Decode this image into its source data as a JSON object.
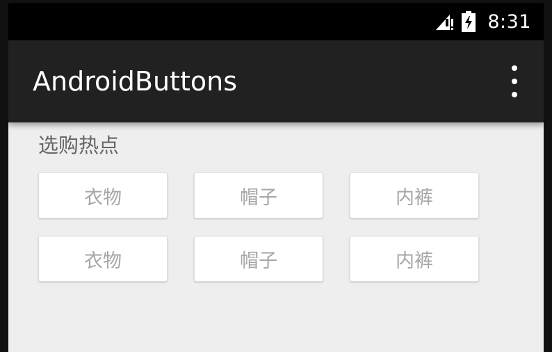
{
  "status_bar": {
    "time": "8:31",
    "icons": [
      "signal-icon",
      "battery-charging-icon"
    ]
  },
  "app_bar": {
    "title": "AndroidButtons",
    "menu_icon": "more-vert-icon"
  },
  "content": {
    "section_title": "选购热点",
    "rows": [
      [
        "衣物",
        "帽子",
        "内裤"
      ],
      [
        "衣物",
        "帽子",
        "内裤"
      ]
    ]
  },
  "colors": {
    "status_bar_bg": "#000000",
    "app_bar_bg": "#212121",
    "content_bg": "#eeeeee",
    "button_bg": "#ffffff",
    "button_text": "#a6a6a6",
    "section_title_text": "#666666"
  }
}
